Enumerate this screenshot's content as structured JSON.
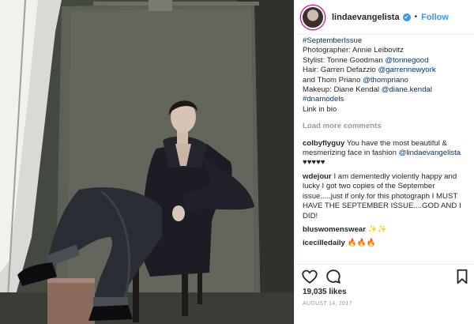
{
  "header": {
    "username": "lindaevangelista",
    "verified_glyph": "✔",
    "separator": "•",
    "follow_label": "Follow"
  },
  "caption": {
    "lines": [
      {
        "text": "#SeptemberIssue",
        "tag": ""
      },
      {
        "text": "Photographer: Annie Leibovitz",
        "tag": ""
      },
      {
        "text": "Stylist: Tonne Goodman ",
        "tag": "@tonnegood"
      },
      {
        "text": "Hair: Garren Defazzio ",
        "tag": "@garrennewyork"
      },
      {
        "text": "and Thom Priano ",
        "tag": "@thompriano"
      },
      {
        "text": "Makeup: Diane Kendal ",
        "tag": "@diane.kendal"
      },
      {
        "text": "#dnamodels",
        "tag": ""
      },
      {
        "text": "Link in bio",
        "tag": ""
      }
    ]
  },
  "load_more_label": "Load more comments",
  "comment_list": [
    {
      "author": "colbyflyguy",
      "text": "You have the most beautiful & mesmerizing face in fashion",
      "tag": "@lindaevangelista",
      "suffix": " ♥♥♥♥♥"
    },
    {
      "author": "wdejour",
      "text": "I am dementedly violently happy and lucky I got two copies of the September issue.....just if only for this photograph I MUST HAVE THE SEPTEMBER ISSUE....GOD AND I DID!",
      "tag": "",
      "suffix": ""
    },
    {
      "author": "bluswomenswear",
      "text": "✨✨",
      "tag": "",
      "suffix": ""
    },
    {
      "author": "icecilledaily",
      "text": "🔥🔥🔥",
      "tag": "",
      "suffix": ""
    }
  ],
  "actions": {
    "icons": [
      "heart-icon",
      "comment-icon",
      "bookmark-icon"
    ]
  },
  "likes": "19,035 likes",
  "date": "AUGUST 14, 2017",
  "colors": {
    "link": "#003569",
    "follow": "#3897f0",
    "muted": "#999999",
    "text": "#262626"
  }
}
